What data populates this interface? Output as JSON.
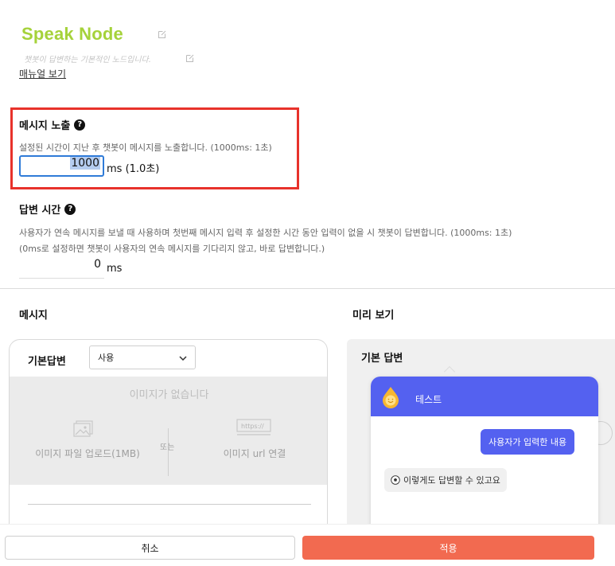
{
  "node": {
    "title": "Speak Node",
    "subtitle": "챗봇이 답변하는 기본적인 노드입니다.",
    "manual_link": "매뉴얼 보기"
  },
  "display_delay": {
    "heading": "메시지 노출",
    "help_icon": "question-circle-icon",
    "description": "설정된 시간이 지난 후 챗봇이 메시지를 노출합니다. (1000ms: 1초)",
    "value": "1000",
    "unit": "ms (1.0초)"
  },
  "answer_wait": {
    "heading": "답변 시간",
    "help_icon": "question-circle-icon",
    "description_line1": "사용자가 연속 메시지를 보낼 때 사용하며 첫번째 메시지 입력 후 설정한 시간 동안 입력이 없을 시 챗봇이 답변합니다. (1000ms: 1초)",
    "description_line2": "(0ms로 설정하면 챗봇이 사용자의 연속 메시지를 기다리지 않고, 바로 답변합니다.)",
    "value": "0",
    "unit": "ms"
  },
  "message_panel": {
    "heading": "메시지",
    "card_label": "기본답변",
    "select_value": "사용",
    "no_image": "이미지가 없습니다",
    "upload_file": "이미지 파일 업로드(1MB)",
    "or": "또는",
    "url_link": "이미지 url 연결",
    "url_badge": "https://"
  },
  "preview_panel": {
    "heading": "미리 보기",
    "card_label": "기본 답변",
    "bot_name": "테스트",
    "user_message": "사용자가 입력한 내용",
    "bot_message": "이렇게도 답변할 수 있고요"
  },
  "footer": {
    "cancel": "취소",
    "apply": "적용"
  },
  "colors": {
    "title": "#a5d23a",
    "highlight": "#e8322b",
    "input_focus": "#2f7bd8",
    "chat_accent": "#5461f0",
    "apply_button": "#f26a50"
  }
}
